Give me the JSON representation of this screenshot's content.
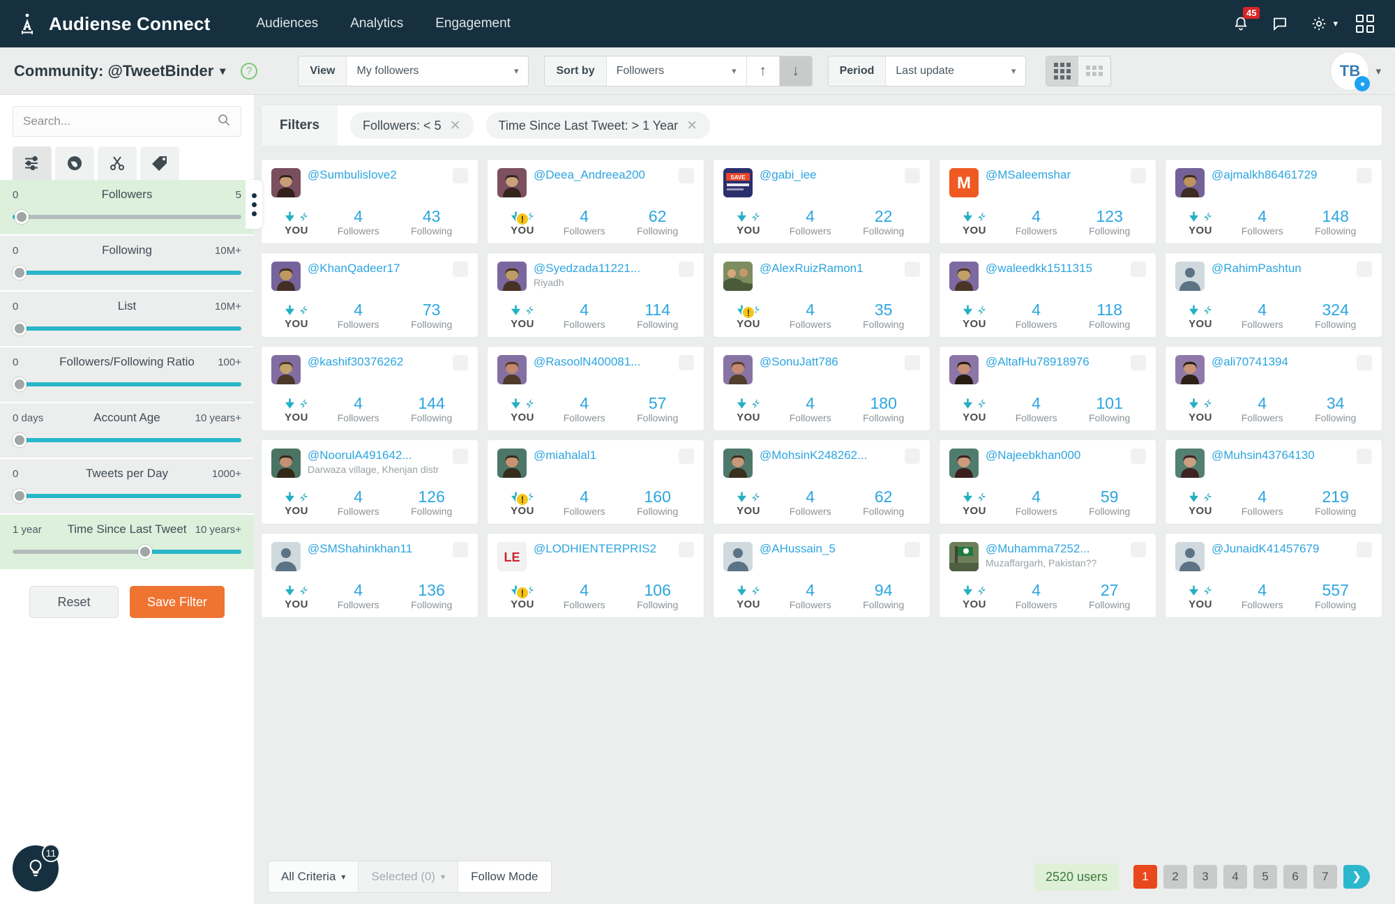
{
  "topnav": {
    "brand": "Audiense Connect",
    "logo_icon": "audiense-logo-icon",
    "links": [
      "Audiences",
      "Analytics",
      "Engagement"
    ],
    "notification_count": "45",
    "bell_icon": "bell-icon",
    "chat_icon": "chat-bubble-icon",
    "gear_icon": "gear-icon",
    "apps_icon": "apps-grid-icon",
    "bg_color": "#16303f"
  },
  "subheader": {
    "community": "Community: @TweetBinder",
    "help_icon": "help-question-icon",
    "view_label": "View",
    "view_value": "My followers",
    "sort_label": "Sort by",
    "sort_value": "Followers",
    "sort_asc_icon": "arrow-up-icon",
    "sort_desc_icon": "arrow-down-icon",
    "period_label": "Period",
    "period_value": "Last update",
    "avatar_initials": "TB",
    "avatar_badge_icon": "twitter-bird-icon"
  },
  "sidebar": {
    "search_placeholder": "Search...",
    "search_value": "",
    "search_icon": "search-icon",
    "tabs": [
      {
        "name": "sliders-icon",
        "active": true
      },
      {
        "name": "globe-icon",
        "active": false
      },
      {
        "name": "scissors-icon",
        "active": false
      },
      {
        "name": "tag-icon",
        "active": false
      }
    ],
    "sliders": [
      {
        "name": "Followers",
        "min": "0",
        "max": "5",
        "highlight": true,
        "fill_start": 0,
        "fill_end": 4,
        "knob": 4
      },
      {
        "name": "Following",
        "min": "0",
        "max": "10M+",
        "highlight": false,
        "fill_start": 3,
        "fill_end": 100,
        "knob": 3
      },
      {
        "name": "List",
        "min": "0",
        "max": "10M+",
        "highlight": false,
        "fill_start": 3,
        "fill_end": 100,
        "knob": 3
      },
      {
        "name": "Followers/Following Ratio",
        "min": "0",
        "max": "100+",
        "highlight": false,
        "fill_start": 3,
        "fill_end": 100,
        "knob": 3
      },
      {
        "name": "Account Age",
        "min": "0 days",
        "max": "10 years+",
        "highlight": false,
        "fill_start": 3,
        "fill_end": 100,
        "knob": 3
      },
      {
        "name": "Tweets per Day",
        "min": "0",
        "max": "1000+",
        "highlight": false,
        "fill_start": 3,
        "fill_end": 100,
        "knob": 3
      },
      {
        "name": "Time Since Last Tweet",
        "min": "1 year",
        "max": "10 years+",
        "highlight": true,
        "fill_start": 58,
        "fill_end": 100,
        "knob": 58
      }
    ],
    "reset_label": "Reset",
    "save_label": "Save Filter"
  },
  "filters_bar": {
    "label": "Filters",
    "chips": [
      "Followers: < 5",
      "Time Since Last Tweet: > 1 Year"
    ],
    "close_icon": "close-x-icon"
  },
  "cards": {
    "you_label": "YOU",
    "followers_label": "Followers",
    "following_label": "Following",
    "down_icon": "follows-you-arrow-icon",
    "bolt_icon": "not-following-back-icon",
    "warn_icon": "warning-exclamation-icon",
    "items": [
      {
        "handle": "@Sumbulislove2",
        "loc": "",
        "followers": "4",
        "following": "43",
        "warn": false,
        "pic": "photo-woman-1"
      },
      {
        "handle": "@Deea_Andreea200",
        "loc": "",
        "followers": "4",
        "following": "62",
        "warn": true,
        "pic": "photo-woman-2"
      },
      {
        "handle": "@gabi_iee",
        "loc": "",
        "followers": "4",
        "following": "22",
        "warn": false,
        "pic": "photo-save-banner"
      },
      {
        "handle": "@MSaleemshar",
        "loc": "",
        "followers": "4",
        "following": "123",
        "warn": false,
        "pic": "letter-m-orange"
      },
      {
        "handle": "@ajmalkh86461729",
        "loc": "",
        "followers": "4",
        "following": "148",
        "warn": false,
        "pic": "photo-man-1"
      },
      {
        "handle": "@KhanQadeer17",
        "loc": "",
        "followers": "4",
        "following": "73",
        "warn": false,
        "pic": "photo-man-2"
      },
      {
        "handle": "@Syedzada11221...",
        "loc": "Riyadh",
        "followers": "4",
        "following": "114",
        "warn": false,
        "pic": "photo-man-3"
      },
      {
        "handle": "@AlexRuizRamon1",
        "loc": "",
        "followers": "4",
        "following": "35",
        "warn": true,
        "pic": "photo-group-1"
      },
      {
        "handle": "@waleedkk1511315",
        "loc": "",
        "followers": "4",
        "following": "118",
        "warn": false,
        "pic": "photo-man-4"
      },
      {
        "handle": "@RahimPashtun",
        "loc": "",
        "followers": "4",
        "following": "324",
        "warn": false,
        "pic": "default-avatar"
      },
      {
        "handle": "@kashif30376262",
        "loc": "",
        "followers": "4",
        "following": "144",
        "warn": false,
        "pic": "photo-man-5"
      },
      {
        "handle": "@RasoolN400081...",
        "loc": "",
        "followers": "4",
        "following": "57",
        "warn": false,
        "pic": "photo-man-6"
      },
      {
        "handle": "@SonuJatt786",
        "loc": "",
        "followers": "4",
        "following": "180",
        "warn": false,
        "pic": "photo-man-7"
      },
      {
        "handle": "@AltafHu78918976",
        "loc": "",
        "followers": "4",
        "following": "101",
        "warn": false,
        "pic": "photo-man-8"
      },
      {
        "handle": "@ali70741394",
        "loc": "",
        "followers": "4",
        "following": "34",
        "warn": false,
        "pic": "photo-man-9"
      },
      {
        "handle": "@NoorulA491642...",
        "loc": "Darwaza village, Khenjan distr",
        "followers": "4",
        "following": "126",
        "warn": false,
        "pic": "photo-man-10"
      },
      {
        "handle": "@miahalal1",
        "loc": "",
        "followers": "4",
        "following": "160",
        "warn": true,
        "pic": "photo-man-11"
      },
      {
        "handle": "@MohsinK248262...",
        "loc": "",
        "followers": "4",
        "following": "62",
        "warn": false,
        "pic": "photo-man-12"
      },
      {
        "handle": "@Najeebkhan000",
        "loc": "",
        "followers": "4",
        "following": "59",
        "warn": false,
        "pic": "photo-man-13"
      },
      {
        "handle": "@Muhsin43764130",
        "loc": "",
        "followers": "4",
        "following": "219",
        "warn": false,
        "pic": "photo-man-14"
      },
      {
        "handle": "@SMShahinkhan11",
        "loc": "",
        "followers": "4",
        "following": "136",
        "warn": false,
        "pic": "default-avatar"
      },
      {
        "handle": "@LODHIENTERPRIS2",
        "loc": "",
        "followers": "4",
        "following": "106",
        "warn": true,
        "pic": "logo-le-red"
      },
      {
        "handle": "@AHussain_5",
        "loc": "",
        "followers": "4",
        "following": "94",
        "warn": false,
        "pic": "default-avatar"
      },
      {
        "handle": "@Muhamma7252...",
        "loc": "Muzaffargarh, Pakistan??",
        "followers": "4",
        "following": "27",
        "warn": false,
        "pic": "photo-flag"
      },
      {
        "handle": "@JunaidK41457679",
        "loc": "",
        "followers": "4",
        "following": "557",
        "warn": false,
        "pic": "default-avatar"
      }
    ]
  },
  "bottom": {
    "all_criteria": "All Criteria",
    "selected": "Selected (0)",
    "follow_mode": "Follow Mode",
    "users_count": "2520 users",
    "pages": [
      "1",
      "2",
      "3",
      "4",
      "5",
      "6",
      "7"
    ],
    "active_page": "1",
    "next_icon": "chevron-right-icon"
  },
  "fab": {
    "icon": "lightbulb-icon",
    "count": "11"
  }
}
